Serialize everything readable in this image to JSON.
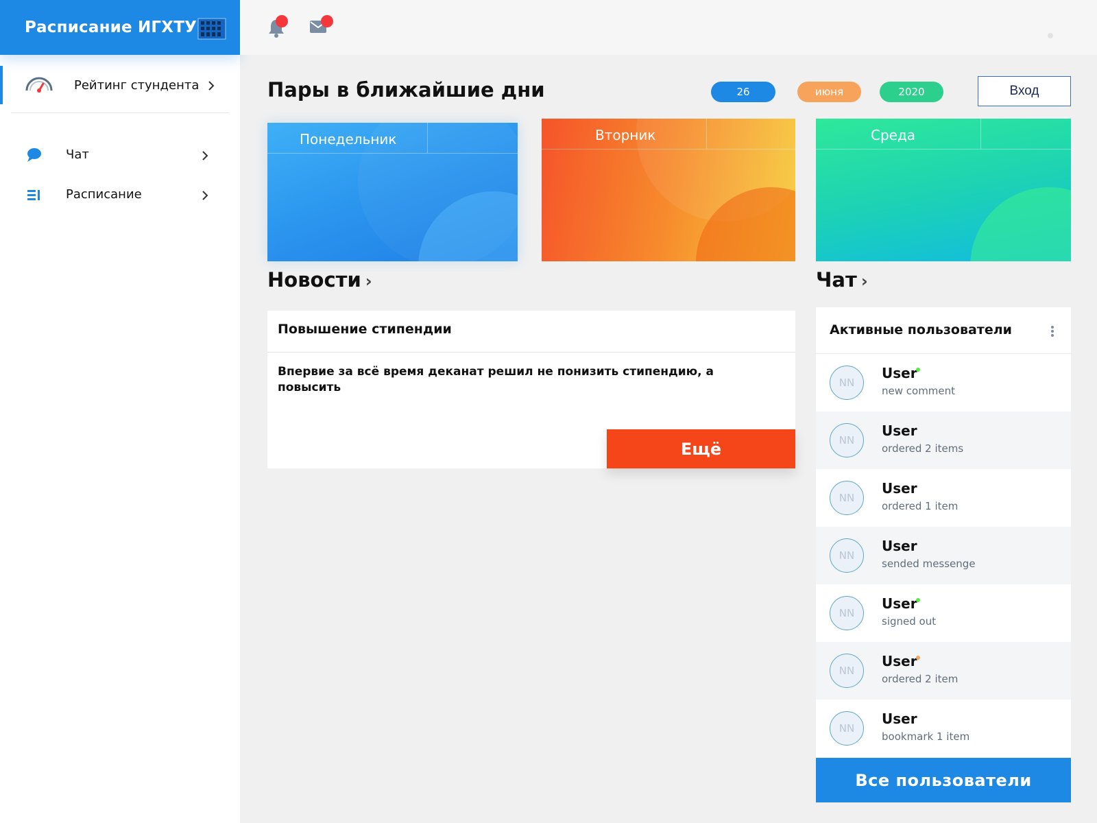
{
  "app": {
    "title": "Расписание ИГХТУ"
  },
  "sidebar": {
    "rating": {
      "label": "Рейтинг стундента"
    },
    "items": [
      {
        "label": "Чат",
        "icon": "chat-bubble-icon"
      },
      {
        "label": "Расписание",
        "icon": "schedule-list-icon"
      }
    ]
  },
  "topbar": {
    "icons": [
      "bell-icon",
      "mail-icon"
    ]
  },
  "main": {
    "title": "Пары в ближайшие дни",
    "date": {
      "day": "26",
      "month": "июня",
      "year": "2020"
    },
    "login_label": "Вход",
    "days": [
      {
        "name": "Понедельник",
        "color": "#1e88e5"
      },
      {
        "name": "Вторник",
        "color": "#f5632a"
      },
      {
        "name": "Среда",
        "color": "#21d99a"
      }
    ]
  },
  "news": {
    "section_title": "Новости",
    "card_title": "Повышение стипендии",
    "text": "Впервие за всё время деканат решил не понизить стипендию, а повысить",
    "more_label": "Ещё"
  },
  "chat": {
    "section_title": "Чат",
    "panel_title": "Активные пользователи",
    "users": [
      {
        "initials": "NN",
        "name": "User",
        "action": "new comment",
        "status": "online"
      },
      {
        "initials": "NN",
        "name": "User",
        "action": "ordered 2 items",
        "status": "none"
      },
      {
        "initials": "NN",
        "name": "User",
        "action": "ordered 1 item",
        "status": "none"
      },
      {
        "initials": "NN",
        "name": "User",
        "action": "sended messenge",
        "status": "none"
      },
      {
        "initials": "NN",
        "name": "User",
        "action": "signed out",
        "status": "online"
      },
      {
        "initials": "NN",
        "name": "User",
        "action": "ordered 2 item",
        "status": "away"
      },
      {
        "initials": "NN",
        "name": "User",
        "action": "bookmark 1 item",
        "status": "none"
      }
    ],
    "all_users_label": "Все пользователи"
  },
  "colors": {
    "accent": "#1e88e5",
    "danger": "#f44619",
    "online": "#5ee64a",
    "away": "#f7a35c",
    "notification": "#f4373a"
  }
}
